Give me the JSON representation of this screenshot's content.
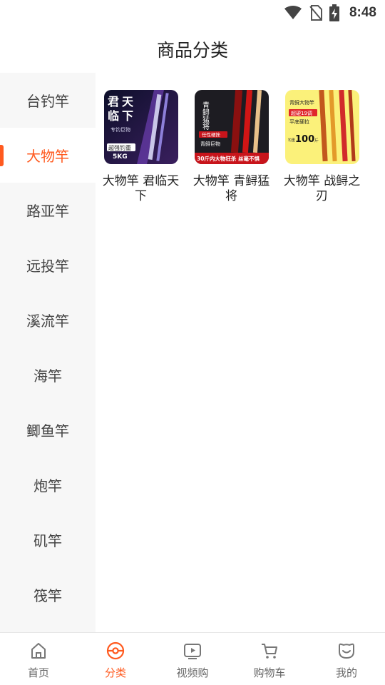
{
  "status": {
    "time": "8:48"
  },
  "header": {
    "title": "商品分类"
  },
  "colors": {
    "accent": "#ff5a1f",
    "sidebar_bg": "#f7f7f7"
  },
  "sidebar": {
    "items": [
      {
        "label": "台钓竿",
        "active": false
      },
      {
        "label": "大物竿",
        "active": true
      },
      {
        "label": "路亚竿",
        "active": false
      },
      {
        "label": "远投竿",
        "active": false
      },
      {
        "label": "溪流竿",
        "active": false
      },
      {
        "label": "海竿",
        "active": false
      },
      {
        "label": "鲫鱼竿",
        "active": false
      },
      {
        "label": "炮竿",
        "active": false
      },
      {
        "label": "矶竿",
        "active": false
      },
      {
        "label": "筏竿",
        "active": false
      }
    ]
  },
  "products": [
    {
      "name": "大物竿 君临天下",
      "image_text": {
        "title_a": "君",
        "title_b": "天",
        "title_c": "临",
        "title_d": "下",
        "subtitle": "专钓巨物",
        "badge": "超强钓重",
        "weight": "5KG"
      }
    },
    {
      "name": "大物竿 青鲟猛将",
      "image_text": {
        "title": "青鲟猛将",
        "tag": "任性硬挫",
        "sub": "青鲟巨物",
        "banner": "30斤内大物狂杀 丝毫不惧"
      }
    },
    {
      "name": "大物竿 战鲟之刃",
      "image_text": {
        "top": "青鲟大物竿",
        "badge": "超硬19调",
        "line": "平底硬拉",
        "weight_prefix": "钓重",
        "weight": "100",
        "unit": "斤"
      }
    }
  ],
  "tabs": [
    {
      "label": "首页",
      "icon": "home-icon",
      "active": false
    },
    {
      "label": "分类",
      "icon": "category-icon",
      "active": true
    },
    {
      "label": "视频购",
      "icon": "video-icon",
      "active": false
    },
    {
      "label": "购物车",
      "icon": "cart-icon",
      "active": false
    },
    {
      "label": "我的",
      "icon": "profile-icon",
      "active": false
    }
  ]
}
